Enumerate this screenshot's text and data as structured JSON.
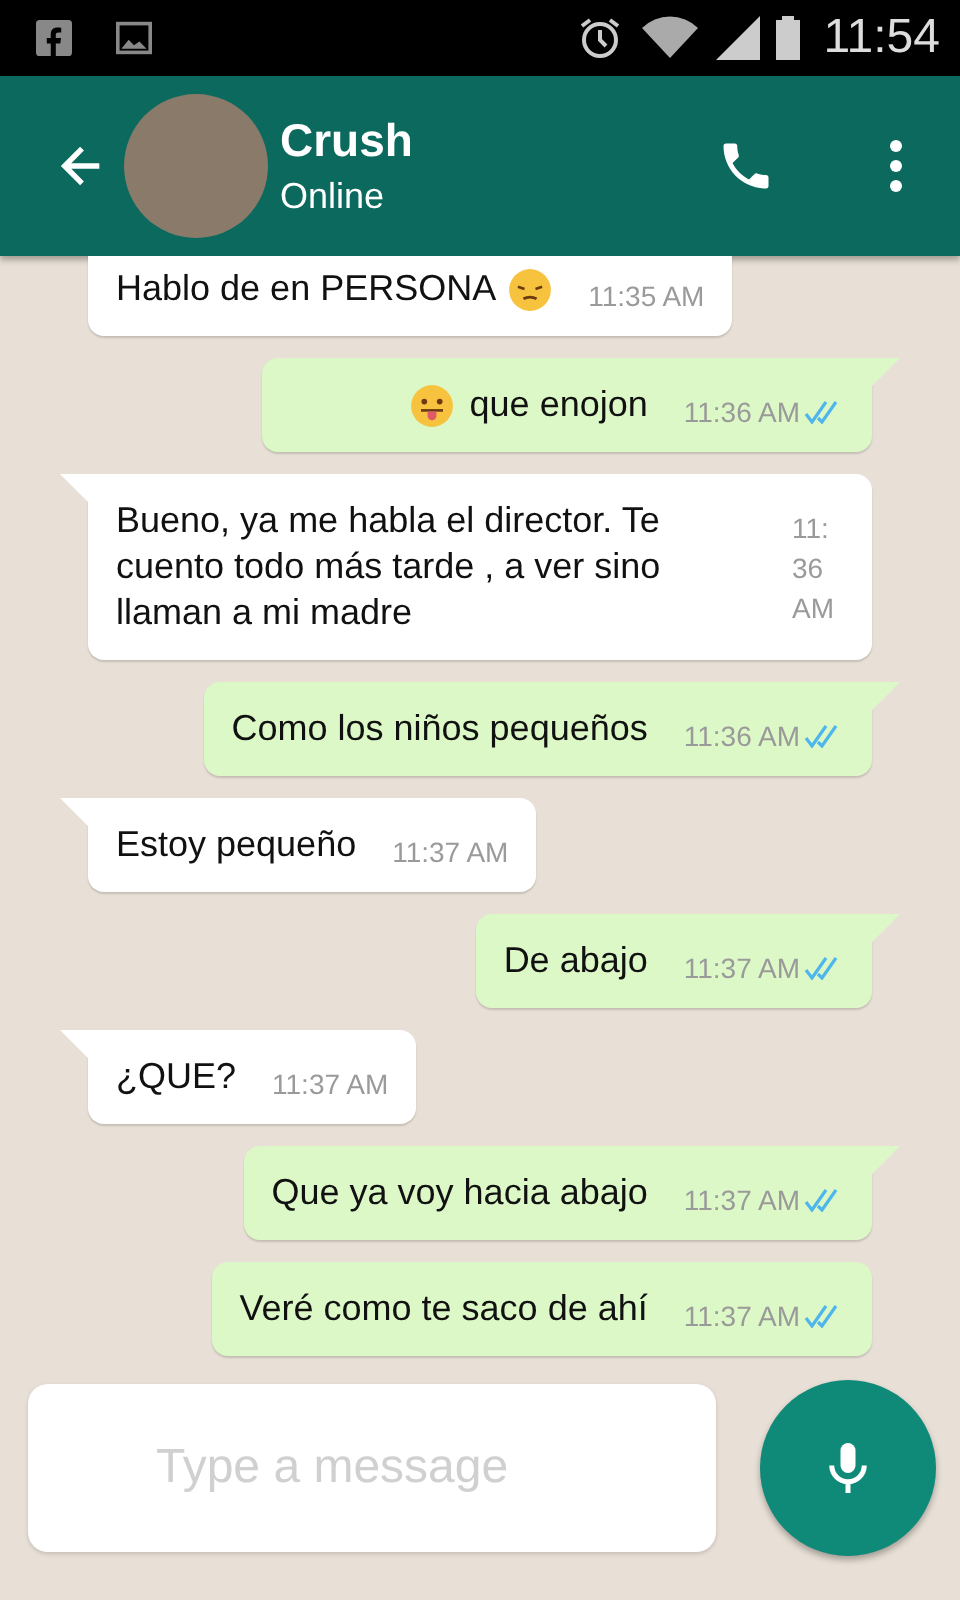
{
  "status_bar": {
    "time": "11:54"
  },
  "header": {
    "name": "Crush",
    "status": "Online"
  },
  "messages": [
    {
      "outgoing": false,
      "tail": false,
      "text": "Hablo de en PERSONA",
      "time": "11:35 AM",
      "emoji": {
        "tongue": false,
        "leading": false
      }
    },
    {
      "outgoing": true,
      "tail": true,
      "text": "que enojon",
      "time": "11:36 AM",
      "read": true,
      "emoji": {
        "tongue": true,
        "leading": true
      }
    },
    {
      "outgoing": false,
      "tail": true,
      "time_stacked": true,
      "text": "Bueno, ya me habla el director. Te cuento todo más tarde , a ver sino llaman a mi madre",
      "time": "11:36 AM"
    },
    {
      "outgoing": true,
      "tail": true,
      "text": "Como los niños pequeños",
      "time": "11:36 AM",
      "read": true
    },
    {
      "outgoing": false,
      "tail": true,
      "text": "Estoy pequeño",
      "time": "11:37 AM"
    },
    {
      "outgoing": true,
      "tail": true,
      "text": "De abajo",
      "time": "11:37 AM",
      "read": true
    },
    {
      "outgoing": false,
      "tail": true,
      "text": "¿QUE?",
      "time": "11:37 AM"
    },
    {
      "outgoing": true,
      "tail": true,
      "text": "Que ya voy hacia abajo",
      "time": "11:37 AM",
      "read": true
    },
    {
      "outgoing": true,
      "tail": false,
      "text": "Veré como te saco de ahí",
      "time": "11:37 AM",
      "read": true
    }
  ],
  "composer": {
    "placeholder": "Type a message"
  }
}
